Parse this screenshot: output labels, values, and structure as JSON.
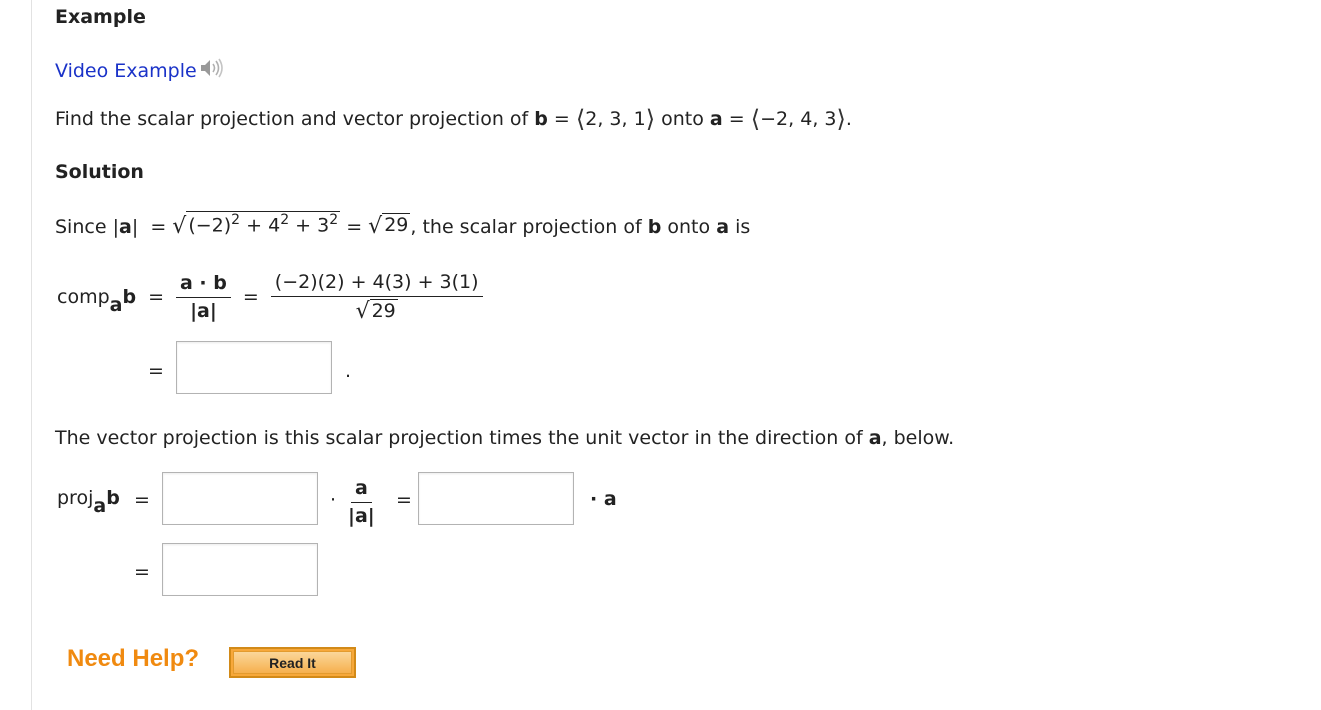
{
  "example": {
    "title": "Example"
  },
  "video": {
    "label": "Video Example"
  },
  "problem": {
    "find_text": "Find the scalar projection and vector projection of",
    "vec_b": "b",
    "eq": "=",
    "b_components": "2, 3, 1",
    "onto": "onto",
    "vec_a": "a",
    "a_components": "−2, 4, 3",
    "end": "."
  },
  "solution": {
    "title": "Solution",
    "since": "Since",
    "abs_a": "|a|",
    "radicand_1": "(−2)",
    "exp_2": "2",
    "plus_4": "+ 4",
    "plus_3": "+ 3",
    "eq": "=",
    "twenty_nine": "29",
    "scalar_text_pre": ", the scalar projection of",
    "b": "b",
    "onto": "onto",
    "a": "a",
    "is": "is"
  },
  "comp": {
    "label": "comp",
    "sub": "a",
    "b": "b",
    "eq": "=",
    "frac1_num": "a · b",
    "frac1_den": "|a|",
    "frac2_num": "(−2)(2) + 4(3) + 3(1)",
    "frac2_den": "29",
    "answer_eq": "=",
    "answer_value": "",
    "period": "."
  },
  "vector_text": {
    "pre": "The vector projection is this scalar projection times the unit vector in the direction of",
    "a": "a",
    "post": ", below."
  },
  "proj": {
    "label": "proj",
    "sub": "a",
    "b": "b",
    "eq": "=",
    "box1_value": "",
    "dot": "·",
    "unit_num": "a",
    "unit_den": "|a|",
    "eq2": "=",
    "box2_value": "",
    "dot_a": "· a",
    "eq3": "=",
    "box3_value": ""
  },
  "help": {
    "need_help": "Need Help?",
    "read_it": "Read It"
  }
}
